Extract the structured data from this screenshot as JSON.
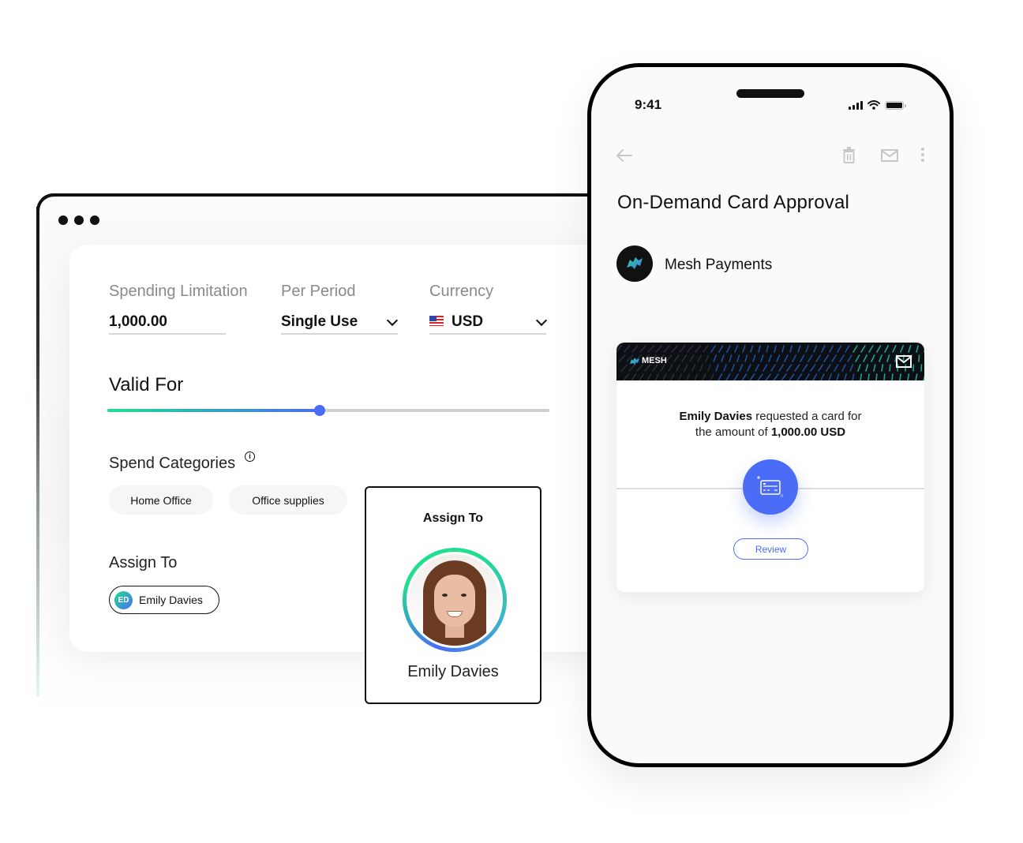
{
  "colors": {
    "accent_blue": "#4a6cf7",
    "accent_green": "#1fe08c",
    "ink": "#111111"
  },
  "browser": {
    "window_controls": [
      "dot",
      "dot",
      "dot"
    ],
    "form": {
      "spending_limitation": {
        "label": "Spending Limitation",
        "value": "1,000.00"
      },
      "per_period": {
        "label": "Per Period",
        "value": "Single Use",
        "icon": "chevron-down-icon"
      },
      "currency": {
        "label": "Currency",
        "value": "USD",
        "flag": "us-flag-icon",
        "icon": "chevron-down-icon"
      },
      "valid_for": {
        "label": "Valid For",
        "slider_fraction": 0.48
      },
      "spend_categories": {
        "label": "Spend Categories",
        "info_icon": "info-icon",
        "info_glyph": "i",
        "chips": [
          "Home Office",
          "Office supplies"
        ]
      },
      "assign_to": {
        "label": "Assign To",
        "assignee": {
          "initials": "ED",
          "name": "Emily Davies"
        }
      }
    },
    "assign_popup": {
      "title": "Assign To",
      "name": "Emily Davies"
    }
  },
  "phone": {
    "status_bar": {
      "time": "9:41",
      "icons": [
        "signal-icon",
        "wifi-icon",
        "battery-icon"
      ]
    },
    "app_bar": {
      "icons": [
        "back-arrow-icon",
        "trash-icon",
        "mail-icon",
        "more-vert-icon"
      ]
    },
    "title": "On-Demand Card Approval",
    "sender": {
      "name": "Mesh Payments",
      "logo": "mesh-logo-icon"
    },
    "email_card": {
      "brand": "MESH",
      "requester": "Emily Davies",
      "text_mid": " requested a card for",
      "text_line2": "the amount of ",
      "amount": "1,000.00 USD",
      "icon": "credit-card-icon",
      "review_label": "Review"
    }
  }
}
